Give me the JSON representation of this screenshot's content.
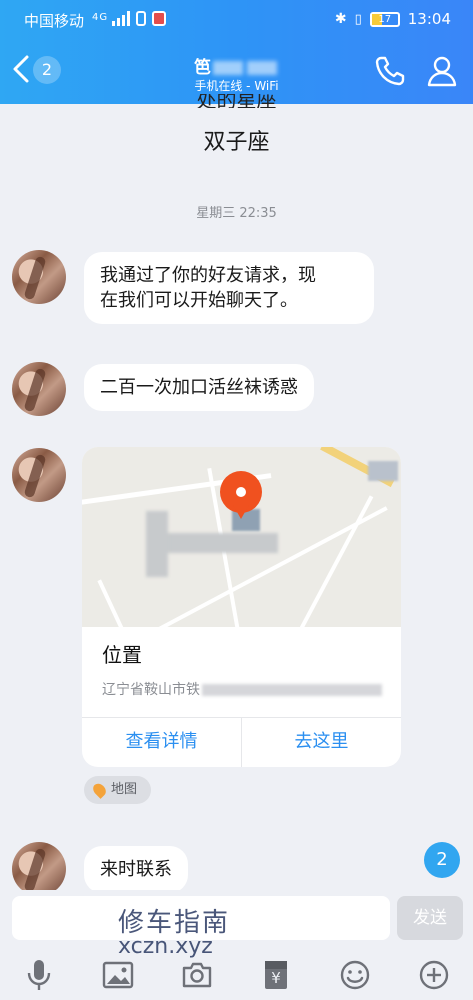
{
  "status_bar": {
    "carrier": "中国移动",
    "network": "4G",
    "battery": "17",
    "time": "13:04"
  },
  "header": {
    "back_count": "2",
    "title_fragment": "笆",
    "subtitle": "手机在线 - WiFi"
  },
  "messages": {
    "cut_text": "处的星座",
    "zodiac": "双子座",
    "timestamp": "星期三 22:35",
    "msg1": "我通过了你的好友请求，现在我们可以开始聊天了。",
    "msg1_line1": "我通过了你的好友请求，现",
    "msg1_line2": "在我们可以开始聊天了。",
    "msg2": "二百一次加口活丝袜诱惑",
    "msg3": "来时联系"
  },
  "location_card": {
    "title": "位置",
    "address": "辽宁省鞍山市铁",
    "btn_details": "查看详情",
    "btn_go": "去这里",
    "source_tag": "地图"
  },
  "unread_badge": "2",
  "composer": {
    "send": "发送"
  },
  "watermark": {
    "line1": "修车指南",
    "line2": "xczn.xyz"
  },
  "toolbar_icons": [
    "mic-icon",
    "image-icon",
    "camera-icon",
    "red-packet-icon",
    "emoji-icon",
    "plus-icon"
  ],
  "colors": {
    "header_start": "#2fa7f3",
    "header_end": "#3a86f8",
    "accent_blue": "#2b8ff0",
    "map_pin": "#f0511f"
  }
}
